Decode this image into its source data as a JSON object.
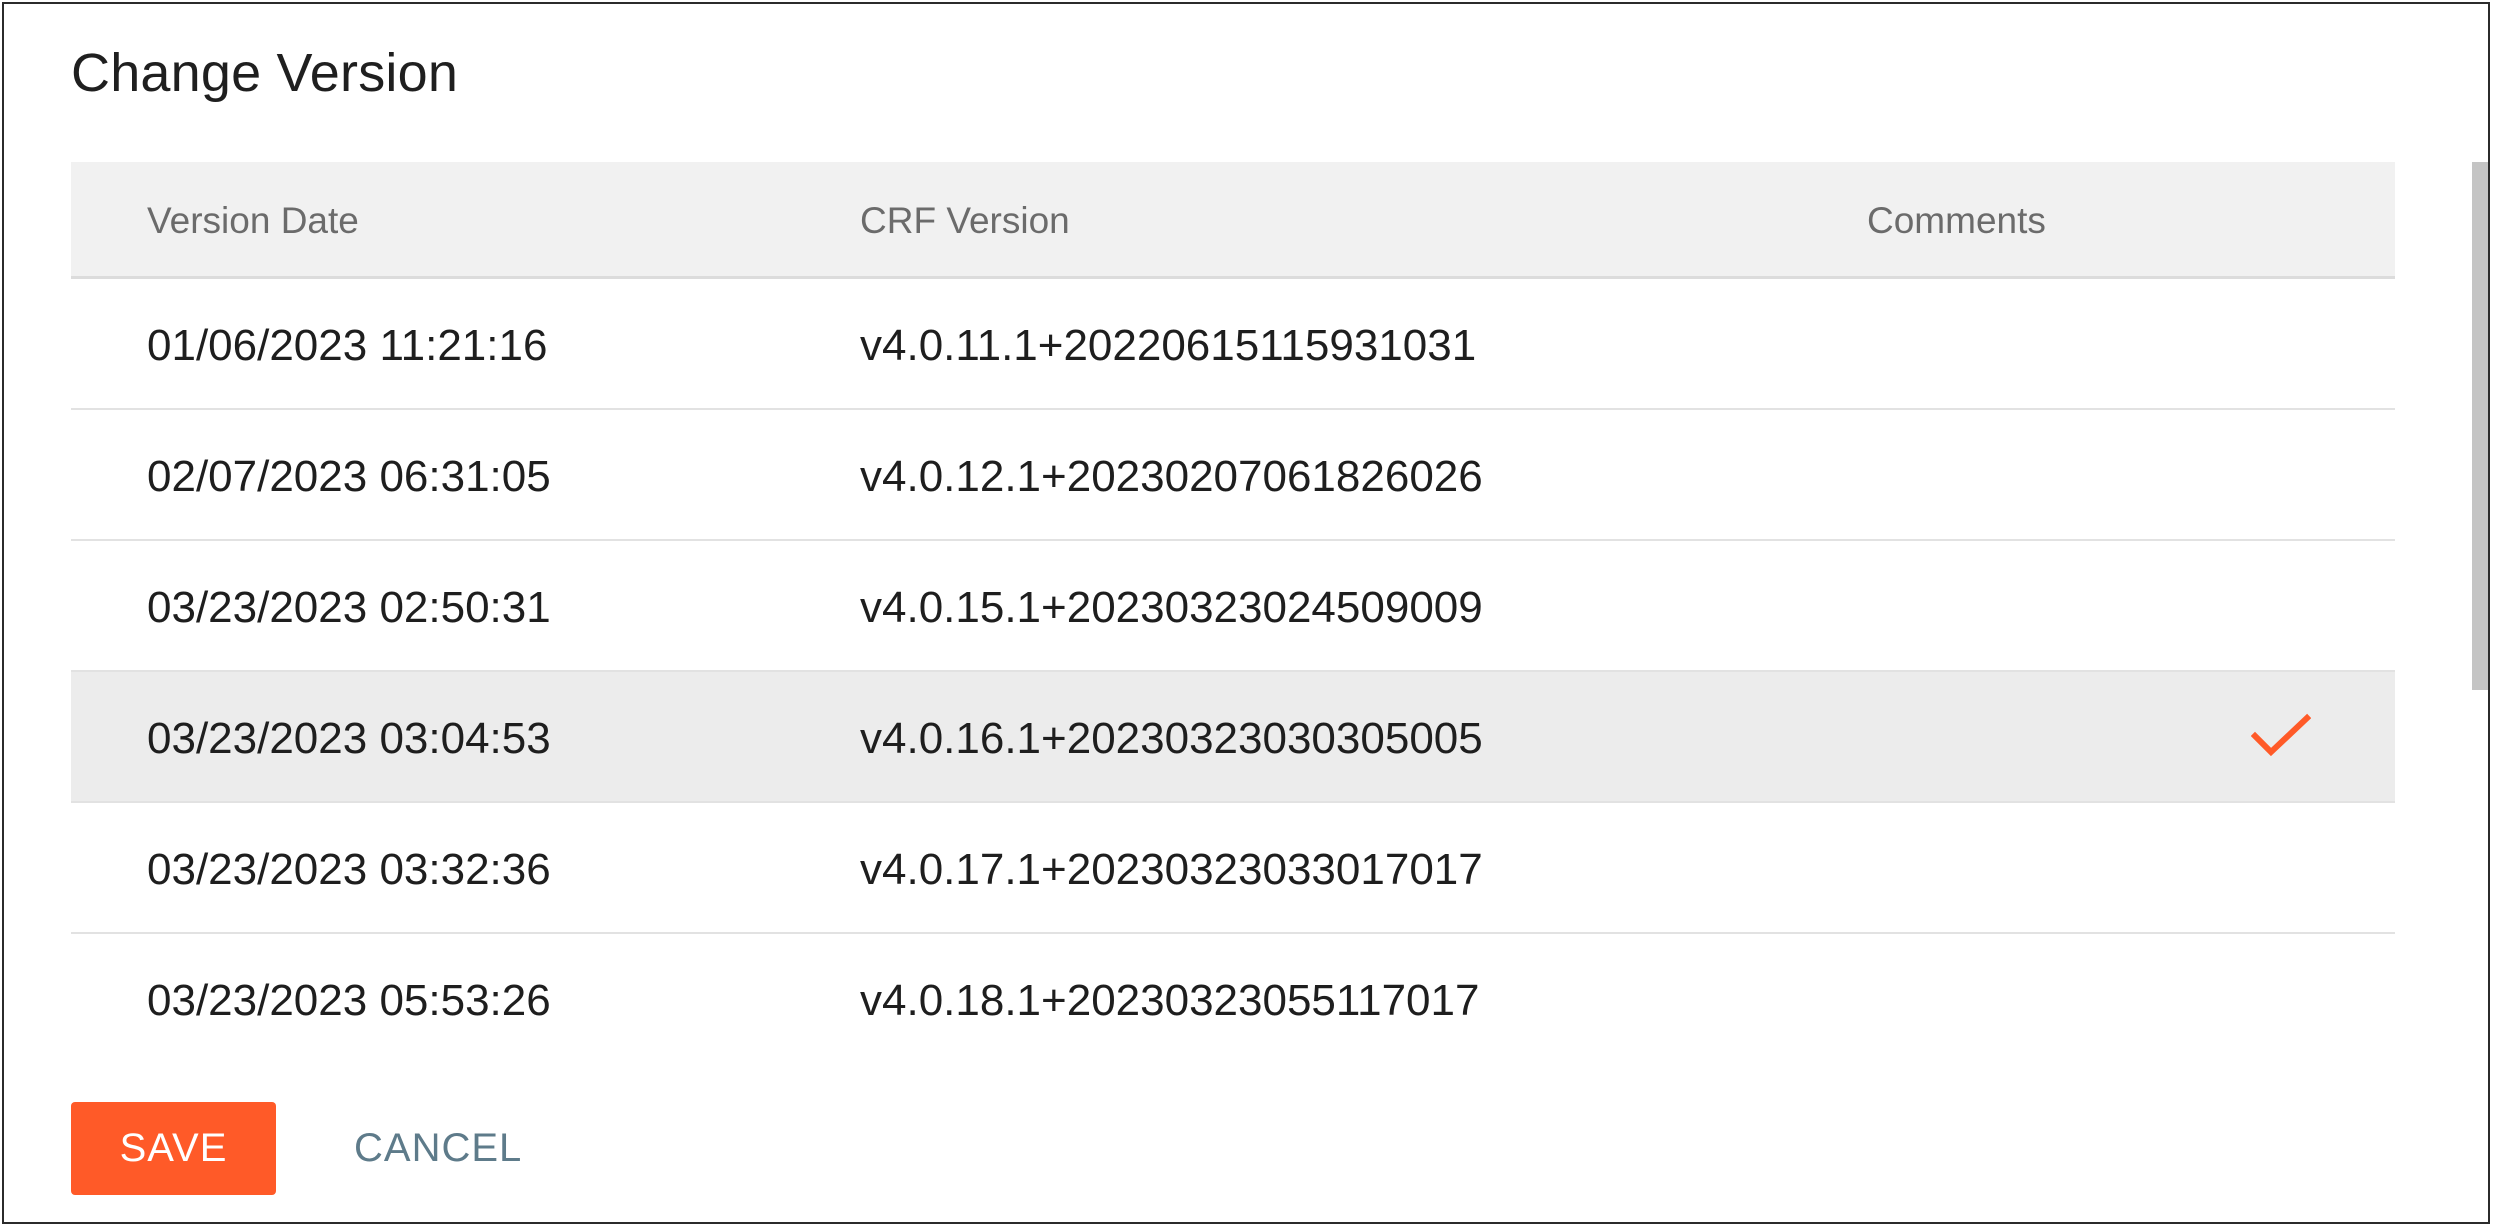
{
  "dialog": {
    "title": "Change Version"
  },
  "table": {
    "headers": {
      "version_date": "Version Date",
      "crf_version": "CRF Version",
      "comments": "Comments"
    },
    "rows": [
      {
        "version_date": "01/06/2023 11:21:16",
        "crf_version": "v4.0.11.1+20220615115931031",
        "comments": "",
        "selected": false
      },
      {
        "version_date": "02/07/2023 06:31:05",
        "crf_version": "v4.0.12.1+20230207061826026",
        "comments": "",
        "selected": false
      },
      {
        "version_date": "03/23/2023 02:50:31",
        "crf_version": "v4.0.15.1+20230323024509009",
        "comments": "",
        "selected": false
      },
      {
        "version_date": "03/23/2023 03:04:53",
        "crf_version": "v4.0.16.1+20230323030305005",
        "comments": "",
        "selected": true
      },
      {
        "version_date": "03/23/2023 03:32:36",
        "crf_version": "v4.0.17.1+20230323033017017",
        "comments": "",
        "selected": false
      },
      {
        "version_date": "03/23/2023 05:53:26",
        "crf_version": "v4.0.18.1+20230323055117017",
        "comments": "",
        "selected": false
      }
    ],
    "selected_icon": "checkmark-icon"
  },
  "actions": {
    "save_label": "SAVE",
    "cancel_label": "CANCEL"
  },
  "colors": {
    "accent": "#ff5a28",
    "cancel_text": "#5e7b8a",
    "header_bg": "#f1f1f1",
    "selected_row_bg": "#ececec"
  }
}
